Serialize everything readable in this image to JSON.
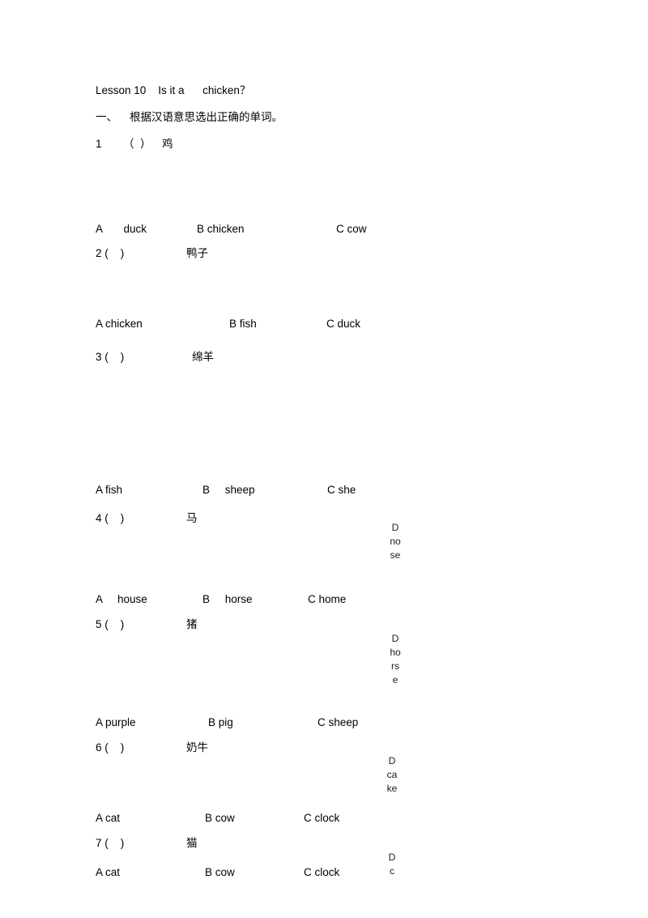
{
  "document": {
    "title_line": "Lesson 10    Is it a      chicken？",
    "section_heading": "一、    根据汉语意思选出正确的单词。",
    "questions": [
      {
        "number": "1",
        "bracket": "（  ）",
        "prompt": "鸡",
        "options": [
          "A       duck",
          "B chicken",
          "C cow"
        ]
      },
      {
        "number": "2 (    )",
        "bracket": "",
        "prompt": "鸭子",
        "options": [
          "A chicken",
          "B fish",
          "C duck"
        ]
      },
      {
        "number": "3 (    )",
        "bracket": "",
        "prompt": "绵羊",
        "options": [
          "A fish",
          "B     sheep",
          "C she"
        ]
      },
      {
        "number": "4 (    )",
        "bracket": "",
        "prompt": "马",
        "options": [
          "A     house",
          "B     horse",
          "C home"
        ]
      },
      {
        "number": "5 (    )",
        "bracket": "",
        "prompt": "猪",
        "options": [
          "A purple",
          "B pig",
          "C sheep"
        ]
      },
      {
        "number": "6 (    )",
        "bracket": "",
        "prompt": "奶牛",
        "options": [
          "A cat",
          "B cow",
          "C clock"
        ]
      },
      {
        "number": "7 (    )",
        "bracket": "",
        "prompt": "猫",
        "options": [
          "A cat",
          "B cow",
          "C clock"
        ]
      }
    ],
    "margin_notes": [
      "Dnose",
      "Dhorse",
      "Dcake",
      "Dc"
    ]
  }
}
